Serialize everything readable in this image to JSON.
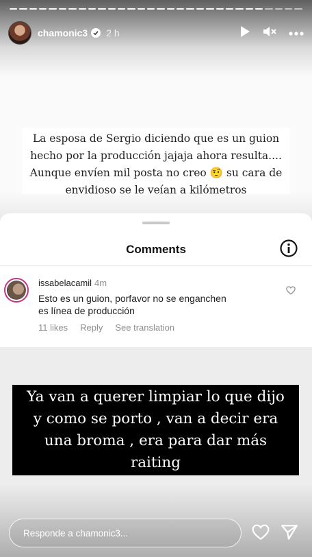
{
  "story": {
    "progress": {
      "total_segments": 30,
      "completed_segments": 26
    },
    "header": {
      "username": "chamonic3",
      "time": "2 h",
      "icons": [
        "play-icon",
        "mute-icon",
        "more-icon"
      ]
    },
    "caption_lines": [
      "La esposa de Sergio diciendo que es un guion",
      "hecho por la producción jajaja ahora resulta....",
      "Aunque envíen mil posta no creo 🤨 su cara de",
      "envidioso se le veían a kilómetros"
    ],
    "comments_sheet": {
      "title": "Comments",
      "comment": {
        "username": "issabelacamil",
        "time": "4m",
        "text_lines": [
          "Esto es un guion,  porfavor no se enganchen",
          "es línea de producción"
        ],
        "likes": "11 likes",
        "reply_label": "Reply",
        "translate_label": "See translation"
      }
    },
    "banner_lines": [
      "Ya van a querer limpiar lo que dijo",
      "y como se porto , van a decir era",
      "una broma , era para dar más",
      "raiting"
    ],
    "footer": {
      "reply_placeholder": "Responde a chamonic3...",
      "icons": [
        "heart-icon",
        "send-icon"
      ]
    }
  }
}
